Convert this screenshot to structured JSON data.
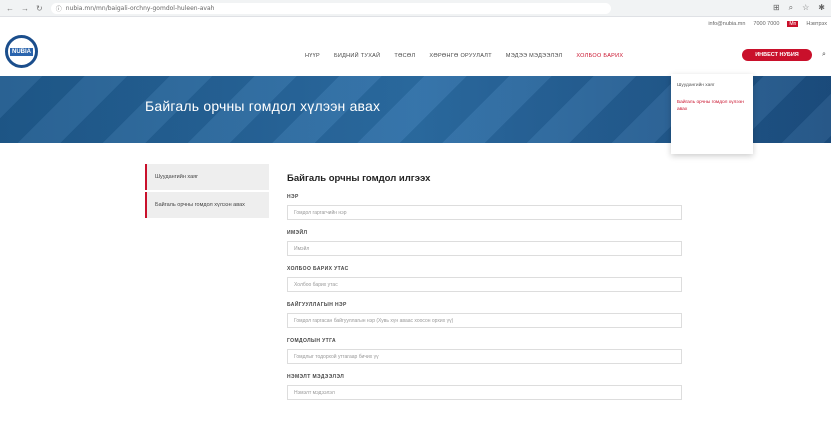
{
  "browser": {
    "url": "nubia.mn/mn/baigali-orchny-gomdol-huleen-avah",
    "nav_icons": [
      "back-icon",
      "forward-icon",
      "reload-icon",
      "site-info-icon"
    ]
  },
  "topinfo": {
    "email": "info@nubia.mn",
    "phone": "7000 7000",
    "lang": "Mn",
    "account": "Нэвтрэх"
  },
  "header": {
    "logo_text": "NUBIA",
    "menu": [
      "НҮҮР",
      "БИДНИЙ ТУХАЙ",
      "ТӨСӨЛ",
      "ХӨРӨНГӨ ОРУУЛАЛТ",
      "МЭДЭЭ МЭДЭЭЛЭЛ",
      "ХОЛБОО БАРИХ"
    ],
    "cta": "ИНВЕСТ НУБИЯ"
  },
  "dropdown": {
    "items": [
      "Шуудангийн хаяг",
      "Байгаль орчны гомдол хүлээн авах"
    ]
  },
  "banner": {
    "title": "Байгаль орчны гомдол хүлээн авах"
  },
  "sidebar": {
    "items": [
      "Шуудангийн хаяг",
      "Байгаль орчны гомдол хүлээн авах"
    ]
  },
  "form": {
    "title": "Байгаль орчны гомдол илгээх",
    "fields": [
      {
        "label": "НЭР",
        "placeholder": "Гомдол гаргагчийн нэр"
      },
      {
        "label": "ИМЭЙЛ",
        "placeholder": "Имэйл"
      },
      {
        "label": "ХОЛБОО БАРИХ УТАС",
        "placeholder": "Холбоо барих утас"
      },
      {
        "label": "БАЙГУУЛЛАГЫН НЭР",
        "placeholder": "Гомдол гаргасан байгууллагын нэр (Хувь хүн аваас хоосон орхих үү)"
      },
      {
        "label": "ГОМДОЛЫН УТГА",
        "placeholder": "Гомдлыг тодорхой утгагаар бичих үү"
      },
      {
        "label": "НЭМЭЛТ МЭДЭЭЛЭЛ",
        "placeholder": "Нэмэлт мэдээлэл"
      }
    ]
  },
  "colors": {
    "accent": "#c9102b",
    "banner": "#2c6ea6",
    "logo": "#1b4e8c"
  }
}
